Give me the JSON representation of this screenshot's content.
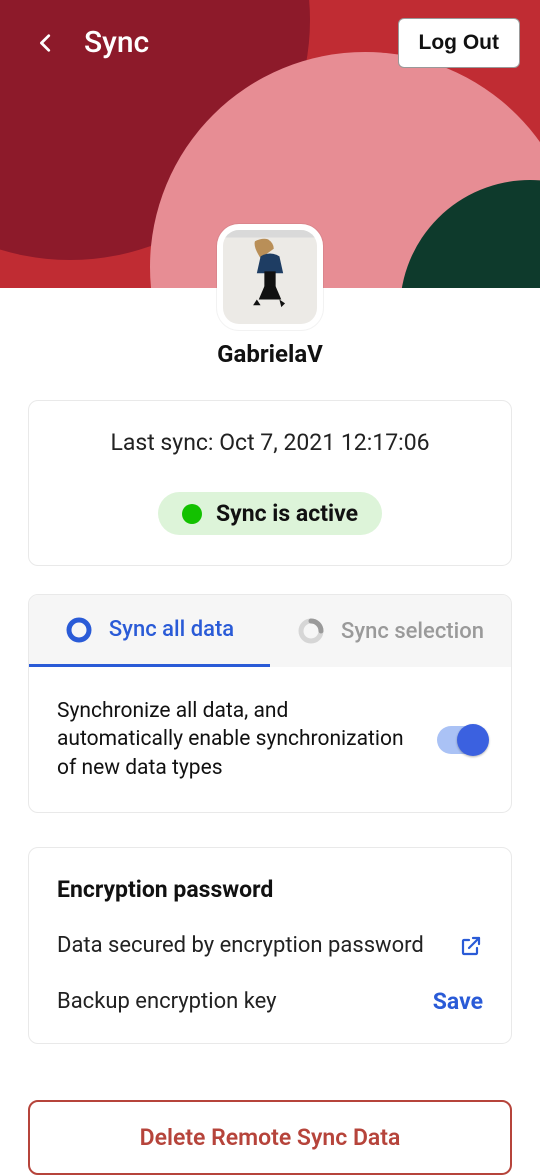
{
  "header": {
    "title": "Sync",
    "logout_label": "Log Out"
  },
  "profile": {
    "username": "GabrielaV"
  },
  "status": {
    "last_sync_label": "Last sync: Oct 7, 2021 12:17:06",
    "status_text": "Sync is active"
  },
  "tabs": {
    "all_label": "Sync all data",
    "selection_label": "Sync selection",
    "all_description": "Synchronize all data, and automatically enable synchronization of new data types"
  },
  "encryption": {
    "title": "Encryption password",
    "secured_label": "Data secured by encryption password",
    "backup_label": "Backup encryption key",
    "save_label": "Save"
  },
  "footer": {
    "delete_label": "Delete Remote Sync Data"
  },
  "colors": {
    "accent": "#2a5bd7",
    "danger": "#b6443b",
    "status_green": "#13c100"
  }
}
